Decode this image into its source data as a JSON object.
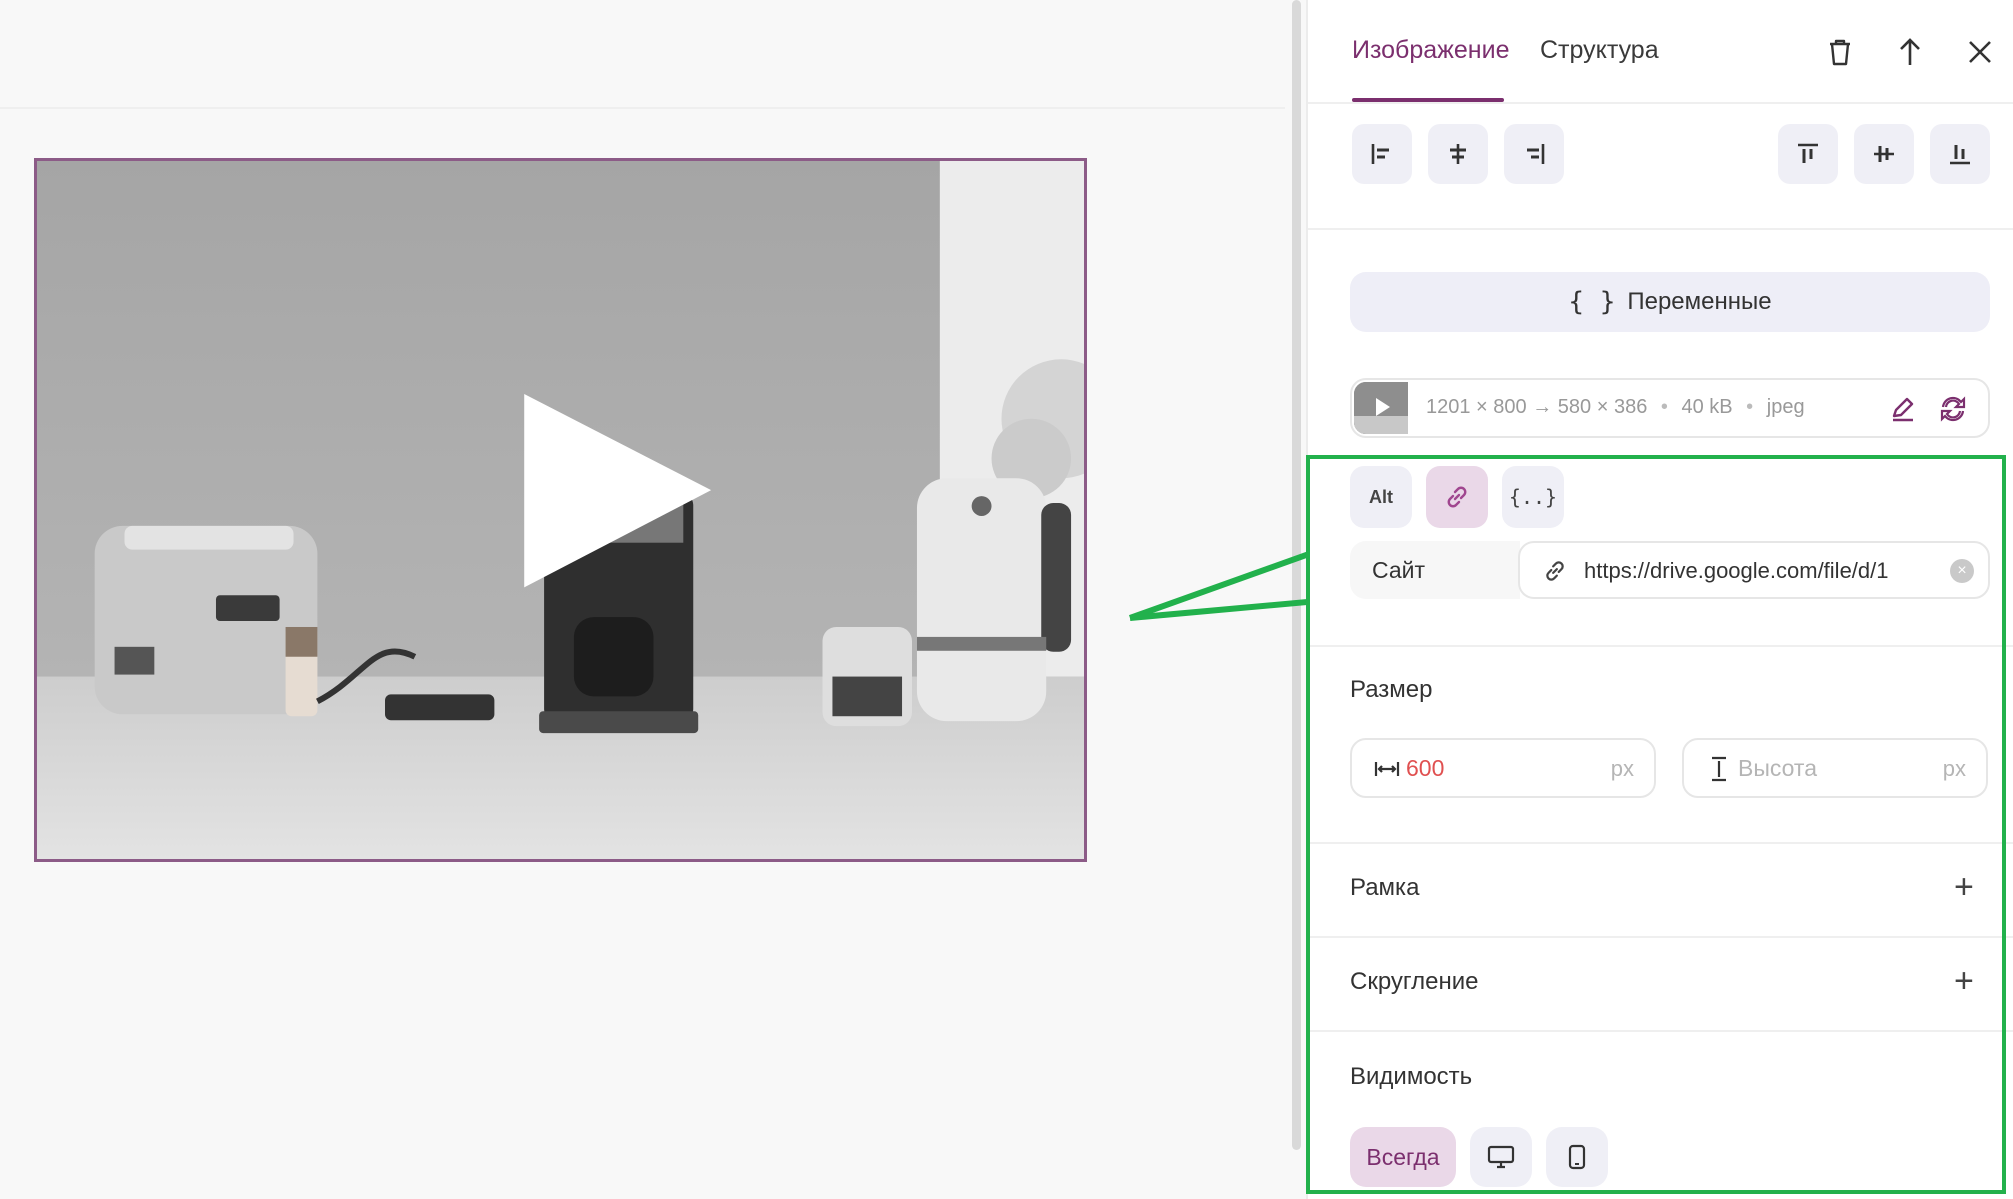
{
  "tabs": [
    {
      "label": "Изображение",
      "active": true
    },
    {
      "label": "Структура",
      "active": false
    }
  ],
  "header_icons": [
    "trash-icon",
    "move-up-icon",
    "close-icon"
  ],
  "align_buttons": [
    "align-left-icon",
    "align-center-h-icon",
    "align-right-icon",
    "align-top-icon",
    "align-center-v-icon",
    "align-bottom-icon"
  ],
  "variables_button": {
    "label": "Переменные",
    "icon": "curly-braces-icon"
  },
  "file_info": {
    "original": "1201 × 800",
    "arrow": "→",
    "scaled": "580 × 386",
    "size": "40 kB",
    "format": "jpeg",
    "separator": "•"
  },
  "image_options": [
    {
      "label": "Alt",
      "name": "alt-text"
    },
    {
      "icon": "link-icon",
      "name": "link",
      "active": true
    },
    {
      "icon": "curly-braces-icon",
      "name": "variables"
    }
  ],
  "link": {
    "type": "Сайт",
    "url": "https://drive.google.com/file/d/1"
  },
  "size": {
    "title": "Размер",
    "width_value": "600",
    "width_unit": "px",
    "height_placeholder": "Высота",
    "height_unit": "px"
  },
  "sections": {
    "border": "Рамка",
    "rounding": "Скругление",
    "visibility": "Видимость"
  },
  "visibility_options": [
    {
      "label": "Всегда",
      "active": true
    },
    {
      "icon": "desktop-icon"
    },
    {
      "icon": "mobile-icon"
    }
  ],
  "colors": {
    "accent": "#7b2f6e",
    "annotation": "#22b14c",
    "error_value": "#e05050"
  }
}
